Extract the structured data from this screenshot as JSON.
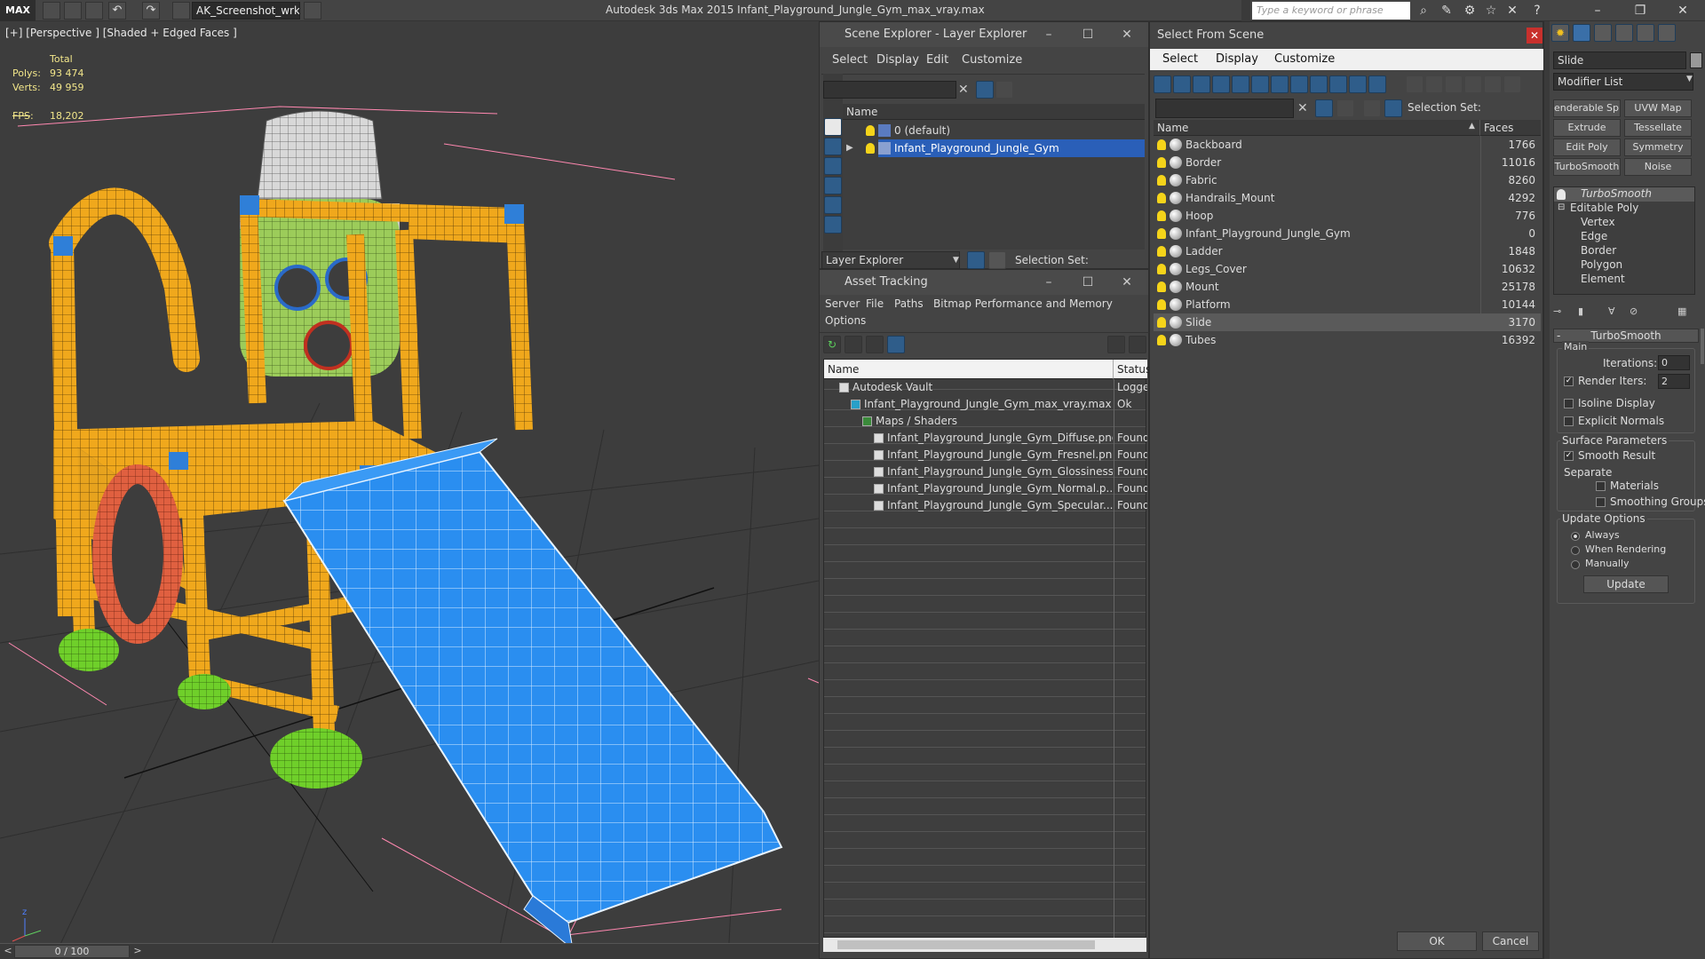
{
  "app": {
    "logo": "MAX",
    "workspace": "AK_Screenshot_wrksp",
    "title": "Autodesk 3ds Max  2015    Infant_Playground_Jungle_Gym_max_vray.max",
    "search_placeholder": "Type a keyword or phrase"
  },
  "viewport": {
    "label": "[+] [Perspective ] [Shaded + Edged Faces ]",
    "stats": {
      "total_label": "Total",
      "polys_label": "Polys:",
      "polys_value": "93 474",
      "verts_label": "Verts:",
      "verts_value": "49 959",
      "fps_label": "FPS:",
      "fps_value": "18,202"
    },
    "time_slider": "0 / 100"
  },
  "scene_explorer": {
    "title": "Scene Explorer - Layer Explorer",
    "menu": [
      "Select",
      "Display",
      "Edit",
      "Customize"
    ],
    "column_name": "Name",
    "layers": [
      {
        "name": "0 (default)",
        "selected": false
      },
      {
        "name": "Infant_Playground_Jungle_Gym",
        "selected": true
      }
    ],
    "footer_dropdown": "Layer Explorer",
    "selection_set_label": "Selection Set:"
  },
  "asset_tracking": {
    "title": "Asset Tracking",
    "menu": [
      "Server",
      "File",
      "Paths",
      "Bitmap Performance and Memory"
    ],
    "menu_row2": [
      "Options"
    ],
    "col_name": "Name",
    "col_status": "Status",
    "rows": [
      {
        "name": "Autodesk Vault",
        "status": "Logge",
        "indent": 1,
        "icon": "vault-icon"
      },
      {
        "name": "Infant_Playground_Jungle_Gym_max_vray.max",
        "status": "Ok",
        "indent": 2,
        "icon": "max-file-icon"
      },
      {
        "name": "Maps / Shaders",
        "status": "",
        "indent": 3,
        "icon": "maps-icon"
      },
      {
        "name": "Infant_Playground_Jungle_Gym_Diffuse.png",
        "status": "Found",
        "indent": 4,
        "icon": "image-file-icon"
      },
      {
        "name": "Infant_Playground_Jungle_Gym_Fresnel.png",
        "status": "Found",
        "indent": 4,
        "icon": "image-file-icon"
      },
      {
        "name": "Infant_Playground_Jungle_Gym_Glossiness...",
        "status": "Found",
        "indent": 4,
        "icon": "image-file-icon"
      },
      {
        "name": "Infant_Playground_Jungle_Gym_Normal.p...",
        "status": "Found",
        "indent": 4,
        "icon": "image-file-icon"
      },
      {
        "name": "Infant_Playground_Jungle_Gym_Specular....",
        "status": "Found",
        "indent": 4,
        "icon": "image-file-icon"
      }
    ]
  },
  "select_from_scene": {
    "title": "Select From Scene",
    "menu": [
      "Select",
      "Display",
      "Customize"
    ],
    "selection_set_label": "Selection Set:",
    "col_name": "Name",
    "col_faces": "Faces",
    "objects": [
      {
        "name": "Backboard",
        "faces": "1766"
      },
      {
        "name": "Border",
        "faces": "11016"
      },
      {
        "name": "Fabric",
        "faces": "8260"
      },
      {
        "name": "Handrails_Mount",
        "faces": "4292"
      },
      {
        "name": "Hoop",
        "faces": "776"
      },
      {
        "name": "Infant_Playground_Jungle_Gym",
        "faces": "0"
      },
      {
        "name": "Ladder",
        "faces": "1848"
      },
      {
        "name": "Legs_Cover",
        "faces": "10632"
      },
      {
        "name": "Mount",
        "faces": "25178"
      },
      {
        "name": "Platform",
        "faces": "10144"
      },
      {
        "name": "Slide",
        "faces": "3170",
        "selected": true
      },
      {
        "name": "Tubes",
        "faces": "16392"
      }
    ],
    "ok": "OK",
    "cancel": "Cancel"
  },
  "command_panel": {
    "object_name": "Slide",
    "modifier_list": "Modifier List",
    "modifier_buttons": [
      "enderable Spli",
      "UVW Map",
      "Extrude",
      "Tessellate",
      "Edit Poly",
      "Symmetry",
      "TurboSmooth",
      "Noise"
    ],
    "stack": [
      "TurboSmooth",
      "Editable Poly",
      "Vertex",
      "Edge",
      "Border",
      "Polygon",
      "Element"
    ],
    "rollout_title": "TurboSmooth",
    "main_label": "Main",
    "iterations_label": "Iterations:",
    "iterations_value": "0",
    "render_iters_label": "Render Iters:",
    "render_iters_value": "2",
    "isoline_label": "Isoline Display",
    "explicit_normals_label": "Explicit Normals",
    "surface_params_label": "Surface Parameters",
    "smooth_result_label": "Smooth Result",
    "separate_label": "Separate",
    "materials_label": "Materials",
    "smoothing_groups_label": "Smoothing Groups",
    "update_options_label": "Update Options",
    "always_label": "Always",
    "when_rendering_label": "When Rendering",
    "manually_label": "Manually",
    "update_button": "Update"
  },
  "colors": {
    "selection_blue": "#2a5fb8",
    "tube_yellow": "#f0a81c",
    "slide_blue": "#2a8ef0",
    "seat_green": "#9ccc5a",
    "leg_green": "#6fcf2a",
    "hoop_red": "#e06040",
    "bulb_yellow": "#f5d41a"
  }
}
